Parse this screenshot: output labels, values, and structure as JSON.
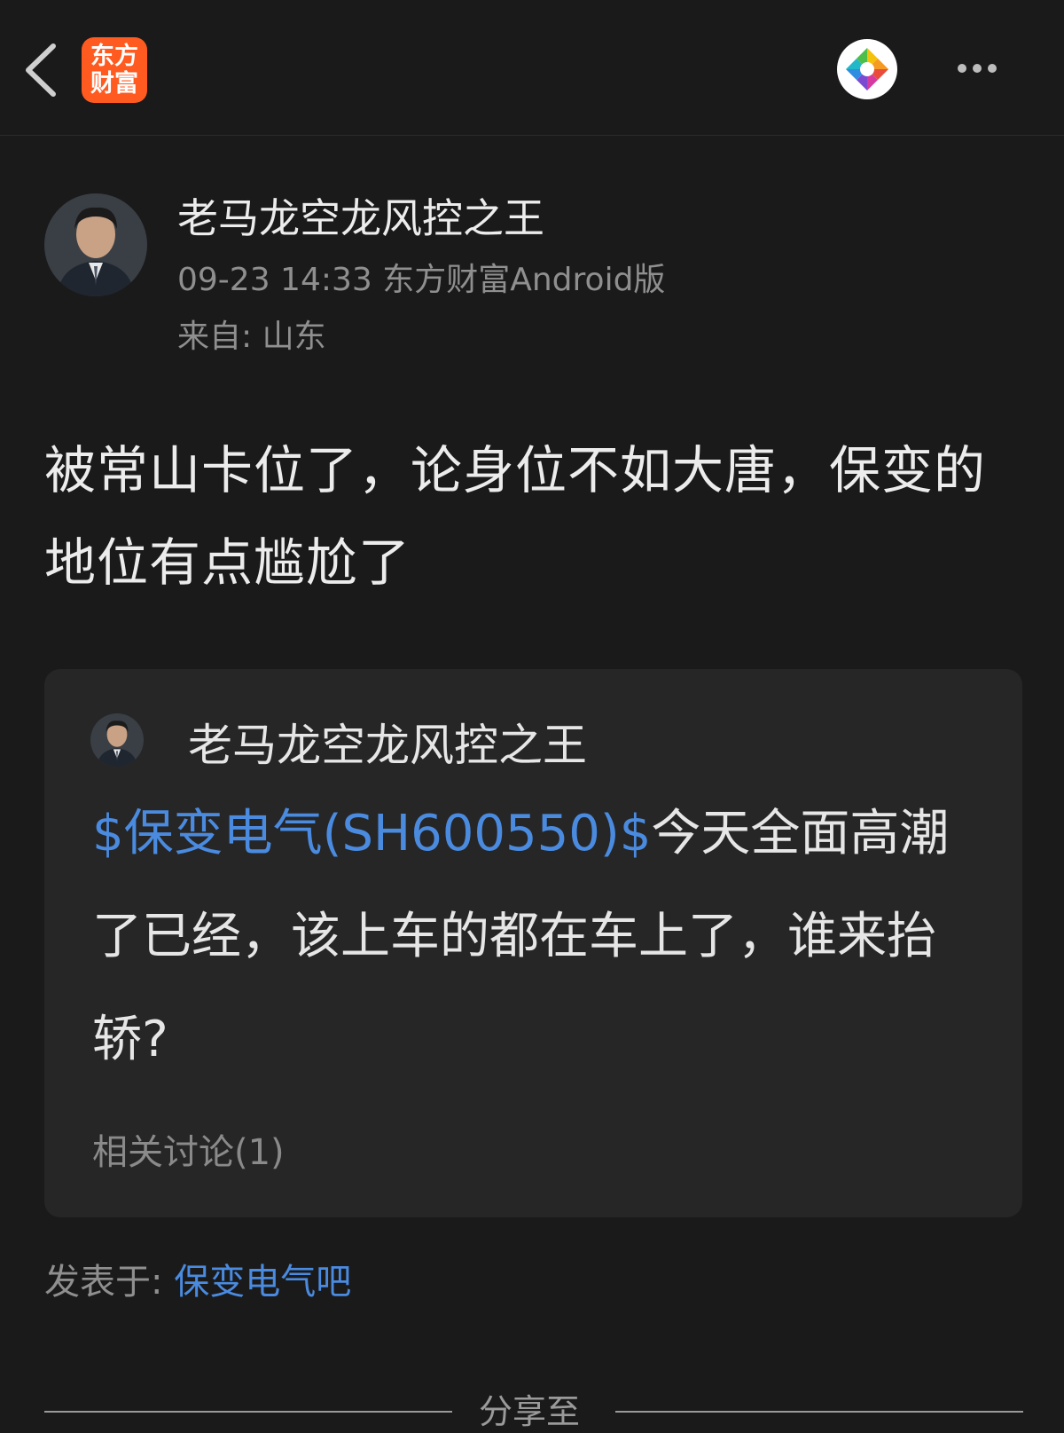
{
  "header": {
    "app_logo_line1": "东方",
    "app_logo_line2": "财富",
    "back_icon": "chevron-left-icon",
    "camera_icon": "camera-aperture-icon",
    "more_icon": "more-horizontal-icon"
  },
  "post": {
    "author": "老马龙空龙风控之王",
    "meta": "09-23 14:33 东方财富Android版",
    "location": "来自: 山东",
    "body": "被常山卡位了，论身位不如大唐，保变的地位有点尴尬了"
  },
  "quote": {
    "author": "老马龙空龙风控之王",
    "stock_tag": "$保变电气(SH600550)$",
    "text": "今天全面高潮了已经，该上车的都在车上了，谁来抬轿?",
    "related": "相关讨论(1)"
  },
  "footer": {
    "posted_in_label": "发表于: ",
    "forum_name": "保变电气吧",
    "share_label": "分享至"
  },
  "colors": {
    "background": "#1a1a1a",
    "card": "#262626",
    "link": "#4a8be0",
    "logo": "#ff5a1f"
  }
}
